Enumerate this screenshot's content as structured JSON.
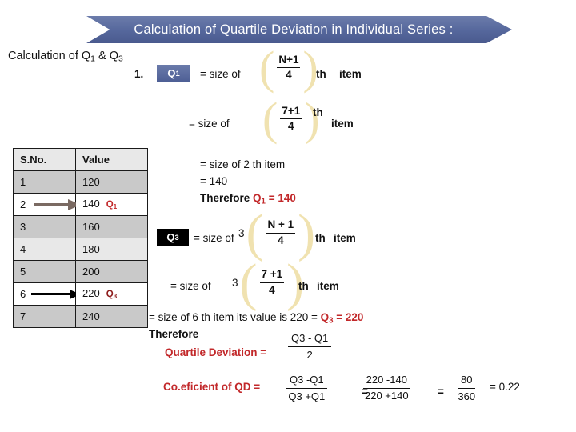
{
  "banner": {
    "title": "Calculation of  Quartile Deviation in Individual Series :",
    "color": "#5b6ea0"
  },
  "heading": "Calculation of Q1 & Q3",
  "q1": {
    "item_number": "1.",
    "badge": "Q1",
    "badge_color": "#5b6ea0",
    "line1": {
      "size_of": "= size of",
      "numerator": "N+1",
      "denominator": "4",
      "th": "th",
      "item": "item"
    },
    "line2": {
      "size_of": "= size of",
      "numerator": "7+1",
      "denominator": "4",
      "th": "th",
      "item": "item"
    },
    "result_line1": "= size of 2 th item",
    "result_line2": "= 140",
    "result_prefix": "Therefore ",
    "result_value": "Q1 = 140",
    "result_color": "#c2282a"
  },
  "q3": {
    "badge": "Q3",
    "badge_color": "#000000",
    "line1": {
      "size_of": "= size of",
      "coefficient": "3",
      "numerator": "N + 1",
      "denominator": "4",
      "th": "th",
      "item": "item"
    },
    "line2": {
      "size_of": "= size of",
      "coefficient": "3",
      "numerator": "7 +1",
      "denominator": "4",
      "th": "th",
      "item": "item"
    },
    "result_text": "= size of 6 th item  its value is 220  = ",
    "result_value": "Q3 = 220",
    "result_color": "#c2282a",
    "therefore": "Therefore"
  },
  "table": {
    "headers": [
      "S.No.",
      "Value"
    ],
    "rows": [
      {
        "sno": "1",
        "value": "120",
        "tag": "",
        "arrow": ""
      },
      {
        "sno": "2",
        "value": "140",
        "tag": "Q1",
        "arrow": "q1"
      },
      {
        "sno": "3",
        "value": "160",
        "tag": "",
        "arrow": ""
      },
      {
        "sno": "4",
        "value": "180",
        "tag": "",
        "arrow": ""
      },
      {
        "sno": "5",
        "value": "200",
        "tag": "",
        "arrow": ""
      },
      {
        "sno": "6",
        "value": "220",
        "tag": "Q3",
        "arrow": "q3"
      },
      {
        "sno": "7",
        "value": "240",
        "tag": "",
        "arrow": ""
      }
    ]
  },
  "quartile_deviation": {
    "label": "Quartile Deviation =",
    "label_color": "#c2282a",
    "numerator": "Q3  - Q1",
    "denominator": "2"
  },
  "coefficient": {
    "label": "Co.eficient of QD =",
    "label_color": "#c2282a",
    "frac1": {
      "num": "Q3 -Q1",
      "den": "Q3 +Q1"
    },
    "eq1": "=",
    "frac2": {
      "num": "220 -140",
      "den": "220 +140"
    },
    "eq2": "=",
    "frac3": {
      "num": "80",
      "den": "360"
    },
    "result": "= 0.22"
  },
  "bracket_color": "#f0e2b0"
}
